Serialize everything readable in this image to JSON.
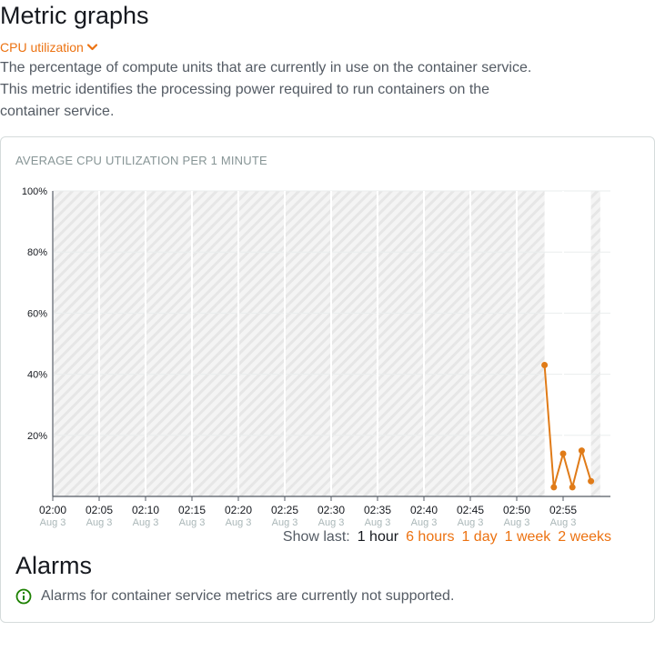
{
  "page": {
    "title": "Metric graphs",
    "metric_select": "CPU utilization",
    "description": "The percentage of compute units that are currently in use on the container service. This metric identifies the processing power required to run containers on the container service."
  },
  "chart": {
    "title": "AVERAGE CPU UTILIZATION PER 1 MINUTE",
    "line_color": "#e07b18"
  },
  "chart_data": {
    "type": "line",
    "title": "AVERAGE CPU UTILIZATION PER 1 MINUTE",
    "xlabel": "",
    "ylabel": "",
    "ylim": [
      0,
      100
    ],
    "y_ticks": [
      "100%",
      "80%",
      "60%",
      "40%",
      "20%"
    ],
    "x_ticks": [
      {
        "time": "02:00",
        "date": "Aug 3"
      },
      {
        "time": "02:05",
        "date": "Aug 3"
      },
      {
        "time": "02:10",
        "date": "Aug 3"
      },
      {
        "time": "02:15",
        "date": "Aug 3"
      },
      {
        "time": "02:20",
        "date": "Aug 3"
      },
      {
        "time": "02:25",
        "date": "Aug 3"
      },
      {
        "time": "02:30",
        "date": "Aug 3"
      },
      {
        "time": "02:35",
        "date": "Aug 3"
      },
      {
        "time": "02:40",
        "date": "Aug 3"
      },
      {
        "time": "02:45",
        "date": "Aug 3"
      },
      {
        "time": "02:50",
        "date": "Aug 3"
      },
      {
        "time": "02:55",
        "date": "Aug 3"
      }
    ],
    "x_range": [
      "02:00",
      "02:58"
    ],
    "no_data_ranges": [
      [
        "02:00",
        "02:53"
      ],
      [
        "02:58",
        "02:59"
      ]
    ],
    "series": [
      {
        "x": [
          "02:53",
          "02:54",
          "02:55",
          "02:56",
          "02:57",
          "02:58"
        ],
        "y": [
          43,
          3,
          14,
          3,
          15,
          5
        ]
      }
    ]
  },
  "show_last": {
    "label": "Show last:",
    "options": [
      "1 hour",
      "6 hours",
      "1 day",
      "1 week",
      "2 weeks"
    ],
    "active": "1 hour"
  },
  "alarms": {
    "title": "Alarms",
    "note": "Alarms for container service metrics are currently not supported.",
    "icon_color": "#1d8102"
  }
}
